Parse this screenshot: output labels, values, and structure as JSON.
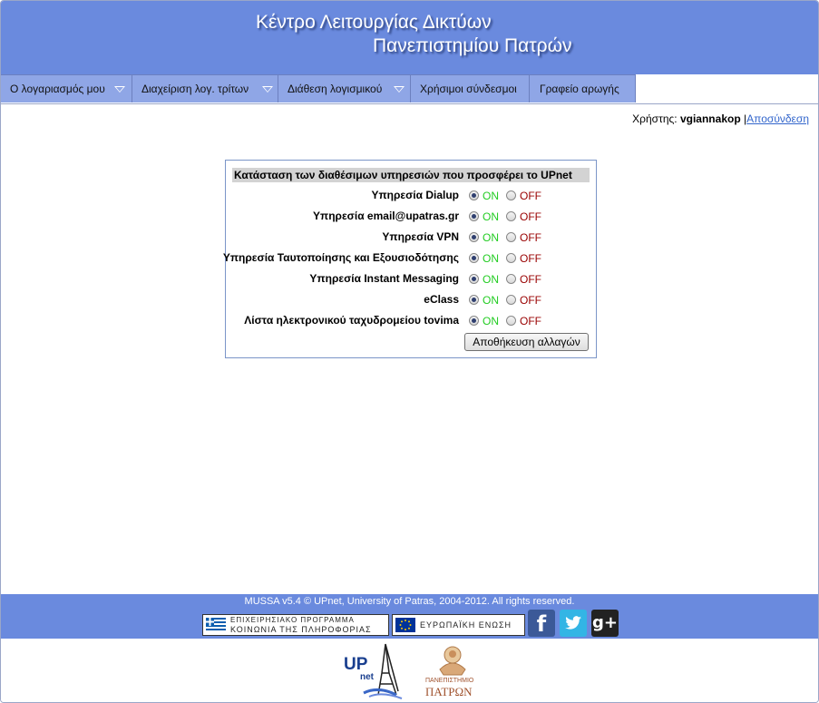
{
  "header": {
    "title_line1": "Κέντρο Λειτουργίας Δικτύων",
    "title_line2": "Πανεπιστημίου Πατρών"
  },
  "menu": [
    {
      "label": "Ο λογαριασμός μου",
      "has_dropdown": true
    },
    {
      "label": "Διαχείριση λογ. τρίτων",
      "has_dropdown": true
    },
    {
      "label": "Διάθεση λογισμικού",
      "has_dropdown": true
    },
    {
      "label": "Χρήσιμοι σύνδεσμοι",
      "has_dropdown": false
    },
    {
      "label": "Γραφείο αρωγής",
      "has_dropdown": false
    }
  ],
  "user": {
    "prefix": "Χρήστης:",
    "username": "vgiannakop",
    "separator": "|",
    "logout_label": "Αποσύνδεση"
  },
  "services_panel": {
    "title": "Κατάσταση των διαθέσιμων υπηρεσιών που προσφέρει το UPnet",
    "on_label": "ON",
    "off_label": "OFF",
    "services": [
      {
        "name": "Υπηρεσία Dialup",
        "state": "ON"
      },
      {
        "name": "Υπηρεσία email@upatras.gr",
        "state": "ON"
      },
      {
        "name": "Υπηρεσία VPN",
        "state": "ON"
      },
      {
        "name": "Υπηρεσία Ταυτοποίησης και Εξουσιοδότησης",
        "state": "ON"
      },
      {
        "name": "Υπηρεσία Instant Messaging",
        "state": "ON"
      },
      {
        "name": "eClass",
        "state": "ON"
      },
      {
        "name": "Λίστα ηλεκτρονικού ταχυδρομείου tovima",
        "state": "ON"
      }
    ],
    "save_label": "Αποθήκευση αλλαγών"
  },
  "footer": {
    "copyright": "MUSSA v5.4 © UPnet, University of Patras, 2004-2012. All rights reserved.",
    "badge_program_line1": "ΕΠΙΧΕΙΡΗΣΙΑΚΟ ΠΡΟΓΡΑΜΜΑ",
    "badge_program_line2": "ΚΟΙΝΩΝΙΑ ΤΗΣ ΠΛΗΡΟΦΟΡΙΑΣ",
    "badge_eu": "ΕΥΡΩΠΑΪΚΗ ΕΝΩΣΗ",
    "social": [
      {
        "icon": "facebook-icon",
        "glyph": "f",
        "color": "#3b5998"
      },
      {
        "icon": "twitter-icon",
        "glyph": "t",
        "color": "#33b5e5"
      },
      {
        "icon": "googleplus-icon",
        "glyph": "g+",
        "color": "#222222"
      }
    ]
  },
  "logos": {
    "upnet_main": "UP",
    "upnet_sub": "net",
    "university_line1": "ΠΑΝΕΠΙΣΤΗΜΙΟ",
    "university_line2": "ΠΑΤΡΩΝ"
  },
  "colors": {
    "brand_blue": "#6a8ade",
    "menu_bg": "#8fa6e6",
    "on_color": "#22cc22",
    "off_color": "#990000",
    "link_color": "#3366cc"
  }
}
